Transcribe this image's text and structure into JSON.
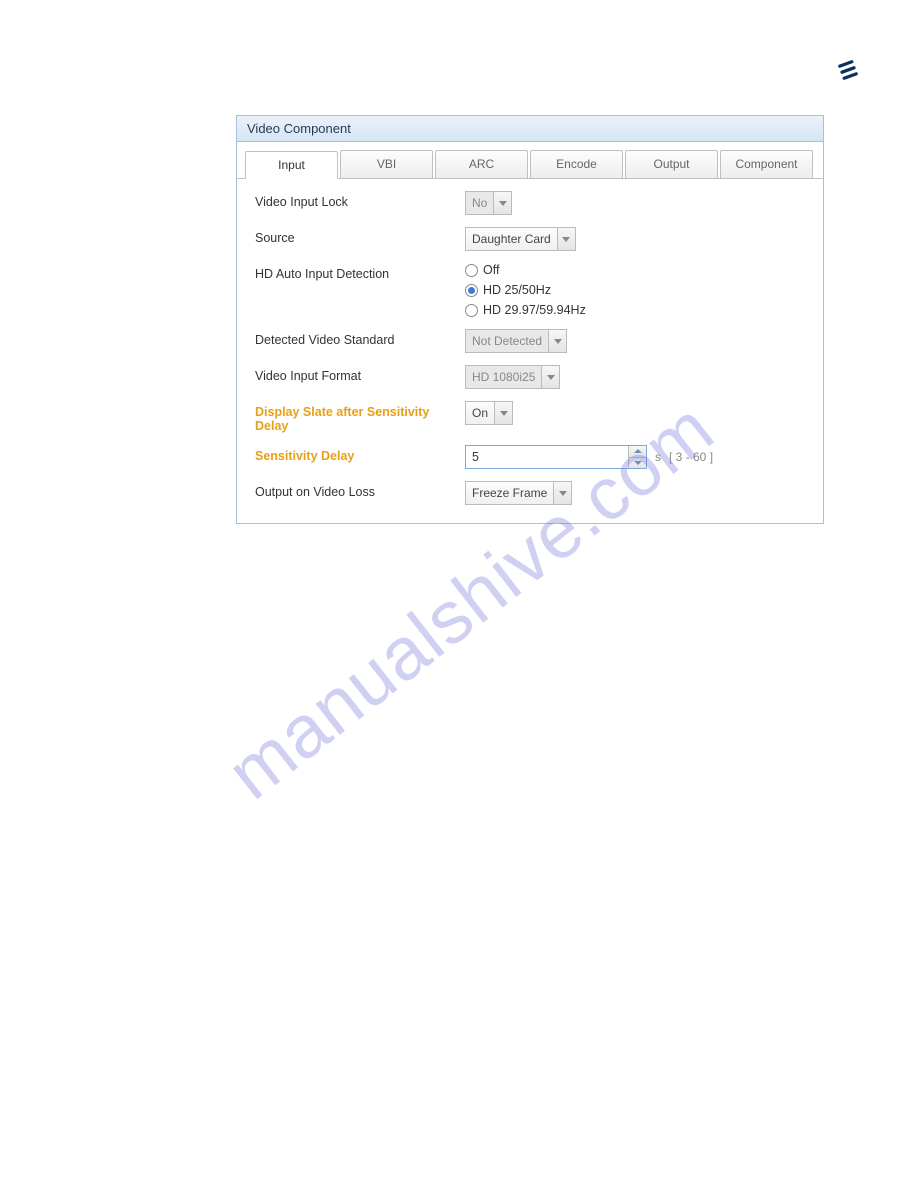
{
  "logo": {
    "name": "ericsson-logo"
  },
  "panel": {
    "title": "Video Component",
    "tabs": [
      "Input",
      "VBI",
      "ARC",
      "Encode",
      "Output",
      "Component"
    ],
    "active_tab": 0
  },
  "form": {
    "video_input_lock": {
      "label": "Video Input Lock",
      "value": "No",
      "disabled": true
    },
    "source": {
      "label": "Source",
      "value": "Daughter Card"
    },
    "hd_auto_input": {
      "label": "HD Auto Input Detection",
      "options": [
        "Off",
        "HD 25/50Hz",
        "HD 29.97/59.94Hz"
      ],
      "selected": 1
    },
    "detected_std": {
      "label": "Detected Video Standard",
      "value": "Not Detected",
      "disabled": true
    },
    "video_input_format": {
      "label": "Video Input Format",
      "value": "HD 1080i25",
      "disabled": true
    },
    "display_slate": {
      "label": "Display Slate after Sensitivity Delay",
      "value": "On",
      "highlight": true
    },
    "sensitivity_delay": {
      "label": "Sensitivity Delay",
      "value": "5",
      "unit": "s",
      "range": "[ 3 - 60 ]",
      "highlight": true
    },
    "output_on_loss": {
      "label": "Output on Video Loss",
      "value": "Freeze Frame"
    }
  },
  "watermark": "manualshive.com"
}
